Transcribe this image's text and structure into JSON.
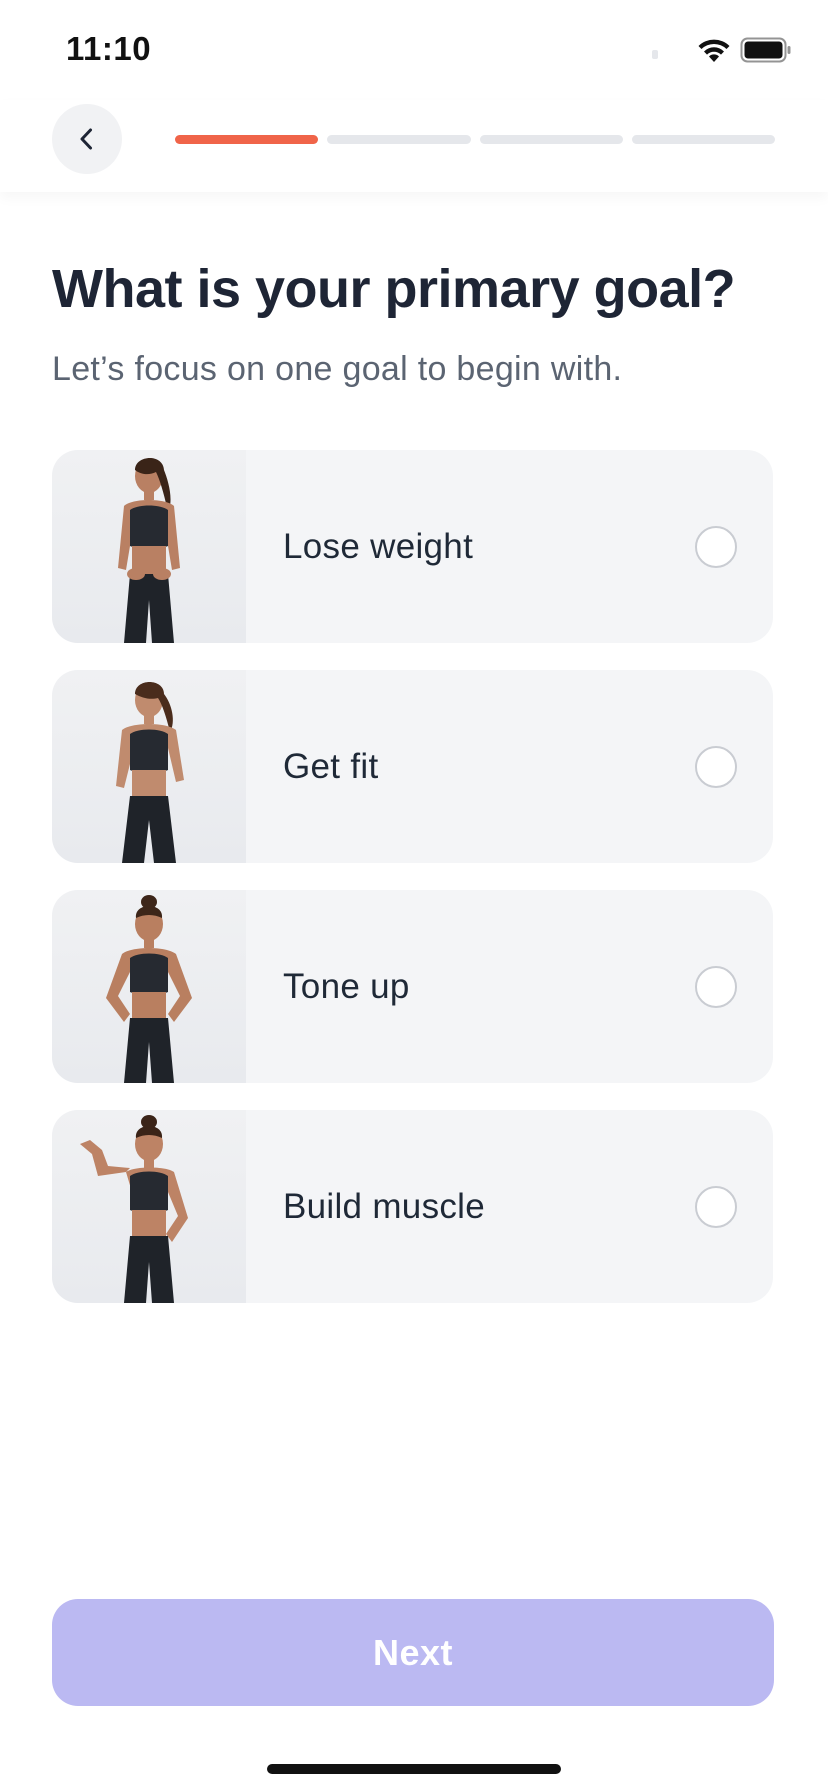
{
  "status_bar": {
    "time": "11:10",
    "icons": [
      "wifi-icon",
      "battery-icon"
    ]
  },
  "header": {
    "back_icon": "chevron-left-icon",
    "progress": {
      "current_step": 1,
      "total_steps": 4
    }
  },
  "main": {
    "title": "What is your primary goal?",
    "subtitle": "Let’s focus on one goal to begin with.",
    "options": [
      {
        "label": "Lose weight",
        "selected": false,
        "image": "woman-measuring-waist"
      },
      {
        "label": "Get fit",
        "selected": false,
        "image": "woman-fitness-pose"
      },
      {
        "label": "Tone up",
        "selected": false,
        "image": "woman-hands-on-hips"
      },
      {
        "label": "Build muscle",
        "selected": false,
        "image": "woman-flexing-bicep"
      }
    ]
  },
  "footer": {
    "next_label": "Next"
  },
  "colors": {
    "accent_progress": "#f06449",
    "progress_inactive": "#e5e7eb",
    "next_button_disabled": "#bbb9f2",
    "option_background": "#f4f5f7"
  }
}
